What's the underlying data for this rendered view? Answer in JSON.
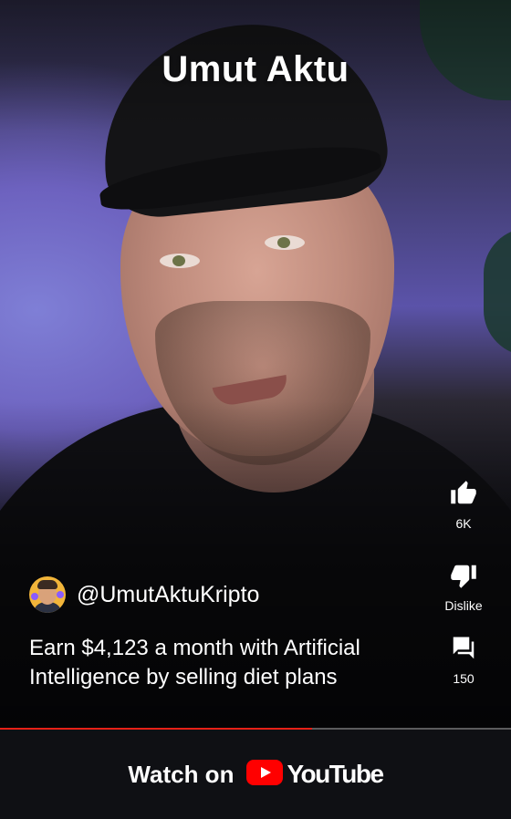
{
  "overlay_title": "Umut Aktu",
  "channel": {
    "handle": "@UmutAktuKripto"
  },
  "description": "Earn $4,123 a month with Artificial Intelligence by selling diet plans",
  "actions": {
    "like_count": "6K",
    "dislike_label": "Dislike",
    "comment_count": "150"
  },
  "progress": {
    "fraction": 0.61,
    "color": "#e62117"
  },
  "footer": {
    "watch_label": "Watch on",
    "brand": "YouTube",
    "brand_color": "#ff0000"
  },
  "icons": [
    "thumbs-up-icon",
    "thumbs-down-icon",
    "comments-icon",
    "youtube-play-icon"
  ]
}
